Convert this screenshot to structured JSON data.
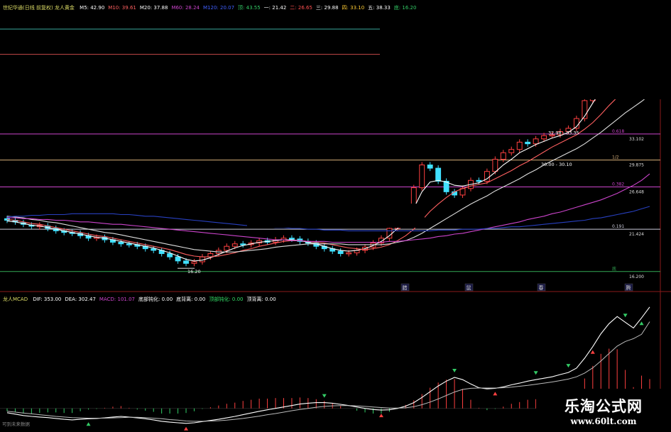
{
  "header1": {
    "title": "世纪华通(日线 前复权) 龙人黄金",
    "ma": [
      {
        "text": "M5: 42.90",
        "color": "#ffffff"
      },
      {
        "text": "M10: 39.61",
        "color": "#ff6060"
      },
      {
        "text": "M20: 37.88",
        "color": "#ffffff"
      },
      {
        "text": "M60: 28.24",
        "color": "#cc44cc"
      },
      {
        "text": "M120: 20.07",
        "color": "#4060ff"
      },
      {
        "text": "顶: 43.55",
        "color": "#33cc66"
      },
      {
        "text": "一: 21.42",
        "color": "#ffffff"
      },
      {
        "text": "二: 26.65",
        "color": "#ff5050"
      },
      {
        "text": "三: 29.88",
        "color": "#ffffff"
      },
      {
        "text": "四: 33.10",
        "color": "#ffcc33"
      },
      {
        "text": "五: 38.33",
        "color": "#ffffff"
      },
      {
        "text": "底: 16.20",
        "color": "#33cc66"
      }
    ]
  },
  "header2": {
    "title": "龙人MCAD",
    "items": [
      {
        "text": "DIF: 353.00",
        "color": "#ffffff"
      },
      {
        "text": "DEA: 302.47",
        "color": "#ffffff"
      },
      {
        "text": "MACD: 101.07",
        "color": "#cc44cc"
      },
      {
        "text": "底部钝化: 0.00",
        "color": "#ffffff"
      },
      {
        "text": "底背离: 0.00",
        "color": "#ffffff"
      },
      {
        "text": "顶部钝化: 0.00",
        "color": "#33dd66"
      },
      {
        "text": "顶背离: 0.00",
        "color": "#ffffff"
      }
    ]
  },
  "overlay_labels": {
    "zone_a": "32.98 - 33.35",
    "zone_b": "30.00 - 30.10",
    "low_price": "16.20",
    "bottom_left": "可到未来数据"
  },
  "logo": {
    "name": "乐淘公式网",
    "url": "www.60lt.com"
  },
  "chart_data": [
    {
      "type": "line",
      "name": "price",
      "ylim": [
        14,
        48
      ],
      "levels": [
        {
          "value": 46.0,
          "color": "#3aa89c",
          "label": ""
        },
        {
          "value": 42.9,
          "color": "#bb4444",
          "label": ""
        },
        {
          "value": 33.1,
          "color": "#cc44cc",
          "label": "0.618",
          "value_label": "33.102"
        },
        {
          "value": 29.9,
          "color": "#d8b07a",
          "label": "1/2",
          "value_label": "29.875"
        },
        {
          "value": 26.6,
          "color": "#cc44cc",
          "label": "0.382",
          "value_label": "26.648"
        },
        {
          "value": 21.4,
          "color": "#ccccdd",
          "label": "0.191",
          "value_label": "21.424"
        },
        {
          "value": 16.2,
          "color": "#33aa55",
          "label": "底",
          "value_label": "16.200"
        }
      ],
      "date_markers": [
        "腊",
        "鼠",
        "春",
        "腾"
      ],
      "close": [
        22.5,
        22.3,
        22.0,
        21.8,
        21.9,
        21.5,
        21.2,
        21.0,
        20.9,
        20.6,
        20.3,
        20.4,
        20.1,
        19.8,
        19.6,
        19.5,
        19.3,
        19.0,
        18.8,
        18.4,
        18.0,
        17.5,
        17.2,
        17.4,
        18.0,
        18.4,
        18.8,
        19.3,
        19.6,
        19.5,
        19.7,
        20.0,
        19.8,
        20.1,
        20.3,
        20.2,
        19.9,
        19.7,
        19.3,
        19.0,
        18.7,
        18.4,
        18.5,
        18.8,
        19.2,
        19.7,
        20.3,
        21.5,
        22.7,
        24.0,
        26.5,
        29.3,
        28.9,
        27.3,
        26.0,
        25.6,
        26.4,
        27.4,
        27.3,
        28.5,
        30.0,
        30.8,
        31.2,
        32.1,
        31.9,
        32.5,
        32.9,
        33.0,
        33.4,
        33.8,
        35.0,
        37.2,
        39.2,
        40.5,
        41.3,
        41.7,
        41.1,
        41.9,
        42.3,
        42.9
      ],
      "open": [
        22.7,
        22.5,
        22.2,
        21.9,
        21.7,
        21.8,
        21.5,
        21.2,
        21.0,
        20.9,
        20.6,
        20.3,
        20.4,
        20.1,
        19.8,
        19.6,
        19.5,
        19.3,
        19.0,
        18.8,
        18.4,
        18.0,
        17.5,
        17.2,
        17.4,
        18.0,
        18.4,
        18.8,
        19.3,
        19.6,
        19.5,
        19.7,
        20.0,
        19.8,
        20.1,
        20.3,
        20.2,
        19.9,
        19.7,
        19.3,
        19.0,
        18.7,
        18.4,
        18.5,
        18.8,
        19.2,
        19.7,
        20.3,
        21.5,
        22.7,
        24.0,
        26.5,
        29.3,
        28.9,
        27.3,
        26.0,
        25.6,
        26.4,
        27.4,
        27.3,
        28.5,
        30.0,
        30.8,
        31.2,
        32.1,
        31.9,
        32.5,
        32.9,
        33.0,
        33.4,
        33.8,
        35.0,
        37.2,
        39.2,
        40.5,
        41.3,
        41.7,
        41.1,
        41.9,
        42.3
      ],
      "series": [
        {
          "name": "M5",
          "color": "#ffffff",
          "values": [
            22.4,
            22.3,
            22.1,
            21.9,
            21.8,
            21.6,
            21.4,
            21.2,
            21.0,
            20.8,
            20.6,
            20.4,
            20.3,
            20.1,
            19.9,
            19.7,
            19.5,
            19.3,
            19.1,
            18.8,
            18.5,
            18.1,
            17.7,
            17.5,
            17.6,
            17.9,
            18.3,
            18.7,
            19.1,
            19.4,
            19.6,
            19.8,
            19.9,
            20.0,
            20.1,
            20.1,
            20.0,
            19.8,
            19.6,
            19.3,
            19.0,
            18.8,
            18.7,
            18.8,
            19.0,
            19.4,
            19.9,
            20.6,
            21.5,
            22.6,
            24.0,
            26.0,
            27.2,
            27.4,
            27.2,
            26.8,
            26.7,
            26.9,
            27.1,
            27.6,
            28.4,
            29.3,
            30.0,
            30.8,
            31.3,
            31.8,
            32.2,
            32.6,
            32.9,
            33.3,
            34.0,
            35.3,
            36.9,
            38.5,
            39.8,
            40.8,
            41.3,
            41.7,
            42.2,
            42.9
          ]
        },
        {
          "name": "M10",
          "color": "#ff6060",
          "values": [
            22.6,
            22.5,
            22.3,
            22.1,
            22.0,
            21.8,
            21.6,
            21.4,
            21.2,
            21.0,
            20.8,
            20.6,
            20.5,
            20.3,
            20.1,
            19.9,
            19.7,
            19.5,
            19.3,
            19.1,
            18.9,
            18.6,
            18.3,
            18.1,
            18.0,
            18.0,
            18.1,
            18.3,
            18.5,
            18.8,
            19.0,
            19.3,
            19.5,
            19.7,
            19.9,
            20.0,
            20.0,
            19.9,
            19.8,
            19.7,
            19.5,
            19.3,
            19.1,
            19.0,
            18.9,
            19.0,
            19.2,
            19.5,
            20.0,
            20.6,
            21.4,
            22.5,
            23.6,
            24.5,
            25.3,
            26.0,
            26.4,
            26.7,
            26.9,
            27.1,
            27.6,
            28.1,
            28.6,
            29.2,
            29.7,
            30.3,
            30.9,
            31.5,
            32.0,
            32.5,
            33.0,
            33.7,
            34.5,
            35.5,
            36.6,
            37.6,
            38.4,
            39.0,
            39.4,
            39.6
          ]
        },
        {
          "name": "M20",
          "color": "#dddddd",
          "values": [
            23.0,
            22.9,
            22.8,
            22.6,
            22.5,
            22.3,
            22.2,
            22.0,
            21.8,
            21.6,
            21.4,
            21.2,
            21.0,
            20.9,
            20.7,
            20.5,
            20.3,
            20.1,
            19.9,
            19.7,
            19.5,
            19.3,
            19.1,
            18.9,
            18.8,
            18.7,
            18.6,
            18.6,
            18.6,
            18.7,
            18.8,
            18.9,
            19.0,
            19.2,
            19.3,
            19.4,
            19.5,
            19.6,
            19.6,
            19.6,
            19.6,
            19.6,
            19.5,
            19.5,
            19.5,
            19.5,
            19.5,
            19.6,
            19.8,
            20.0,
            20.4,
            20.9,
            21.5,
            22.1,
            22.7,
            23.3,
            23.9,
            24.5,
            25.0,
            25.5,
            26.1,
            26.6,
            27.1,
            27.6,
            28.2,
            28.7,
            29.3,
            29.8,
            30.3,
            30.8,
            31.3,
            31.9,
            32.6,
            33.3,
            34.1,
            34.9,
            35.7,
            36.4,
            37.1,
            37.9
          ]
        },
        {
          "name": "M60",
          "color": "#cc44cc",
          "values": [
            22.8,
            22.8,
            22.7,
            22.7,
            22.6,
            22.6,
            22.5,
            22.5,
            22.4,
            22.3,
            22.3,
            22.2,
            22.1,
            22.0,
            22.0,
            21.9,
            21.8,
            21.7,
            21.6,
            21.5,
            21.4,
            21.3,
            21.2,
            21.1,
            21.0,
            20.9,
            20.8,
            20.7,
            20.6,
            20.5,
            20.4,
            20.3,
            20.2,
            20.1,
            20.1,
            20.0,
            20.0,
            19.9,
            19.9,
            19.9,
            19.8,
            19.8,
            19.8,
            19.8,
            19.8,
            19.8,
            19.8,
            19.9,
            19.9,
            20.0,
            20.1,
            20.2,
            20.3,
            20.5,
            20.6,
            20.8,
            20.9,
            21.1,
            21.3,
            21.5,
            21.7,
            21.9,
            22.1,
            22.3,
            22.6,
            22.8,
            23.0,
            23.3,
            23.5,
            23.8,
            24.1,
            24.4,
            24.7,
            25.0,
            25.4,
            25.8,
            26.3,
            26.8,
            27.4,
            28.2
          ]
        },
        {
          "name": "M120",
          "color": "#2840c0",
          "values": [
            22.9,
            23.0,
            23.0,
            23.1,
            23.1,
            23.2,
            23.2,
            23.2,
            23.3,
            23.3,
            23.3,
            23.3,
            23.3,
            23.3,
            23.2,
            23.2,
            23.1,
            23.0,
            23.0,
            22.9,
            22.8,
            22.7,
            22.6,
            22.5,
            22.4,
            22.3,
            22.2,
            22.1,
            22.0,
            21.9,
            21.8,
            21.8,
            21.7,
            21.6,
            21.6,
            21.5,
            21.5,
            21.4,
            21.4,
            21.3,
            21.3,
            21.3,
            21.2,
            21.2,
            21.2,
            21.2,
            21.2,
            21.2,
            21.2,
            21.2,
            21.2,
            21.2,
            21.2,
            21.3,
            21.3,
            21.3,
            21.4,
            21.4,
            21.4,
            21.5,
            21.5,
            21.6,
            21.7,
            21.7,
            21.8,
            21.9,
            22.0,
            22.1,
            22.2,
            22.3,
            22.4,
            22.5,
            22.7,
            22.8,
            23.0,
            23.2,
            23.4,
            23.6,
            23.9,
            24.2
          ]
        }
      ]
    },
    {
      "type": "bar",
      "name": "龙人MCAD",
      "ylim": [
        -60,
        360
      ],
      "dif": [
        -15,
        -20,
        -25,
        -28,
        -30,
        -32,
        -35,
        -38,
        -40,
        -38,
        -36,
        -35,
        -33,
        -30,
        -28,
        -30,
        -33,
        -36,
        -40,
        -45,
        -48,
        -50,
        -52,
        -50,
        -46,
        -42,
        -38,
        -33,
        -28,
        -22,
        -16,
        -10,
        -5,
        0,
        5,
        10,
        15,
        18,
        20,
        20,
        18,
        14,
        10,
        5,
        0,
        -4,
        -6,
        -5,
        0,
        8,
        20,
        38,
        58,
        78,
        95,
        108,
        100,
        85,
        72,
        68,
        70,
        75,
        82,
        88,
        95,
        100,
        105,
        110,
        118,
        125,
        140,
        175,
        215,
        260,
        295,
        320,
        300,
        280,
        315,
        353
      ],
      "dea": [
        -10,
        -13,
        -16,
        -19,
        -22,
        -25,
        -28,
        -30,
        -32,
        -33,
        -34,
        -34,
        -34,
        -33,
        -32,
        -31,
        -31,
        -32,
        -34,
        -36,
        -39,
        -41,
        -44,
        -45,
        -45,
        -44,
        -43,
        -41,
        -38,
        -35,
        -31,
        -27,
        -22,
        -18,
        -13,
        -8,
        -4,
        0,
        4,
        7,
        9,
        10,
        10,
        9,
        7,
        5,
        3,
        1,
        1,
        2,
        6,
        13,
        22,
        33,
        45,
        57,
        66,
        70,
        71,
        71,
        71,
        72,
        74,
        77,
        80,
        84,
        88,
        92,
        97,
        102,
        110,
        123,
        141,
        165,
        191,
        217,
        233,
        243,
        258,
        302
      ],
      "markers": [
        {
          "index": 10,
          "type": "up",
          "color": "#33cc66"
        },
        {
          "index": 22,
          "type": "up",
          "color": "#ff4040"
        },
        {
          "index": 39,
          "type": "down",
          "color": "#33cc66"
        },
        {
          "index": 46,
          "type": "up",
          "color": "#ff4040"
        },
        {
          "index": 55,
          "type": "down",
          "color": "#33cc66"
        },
        {
          "index": 60,
          "type": "up",
          "color": "#ff4040"
        },
        {
          "index": 65,
          "type": "down",
          "color": "#33cc66"
        },
        {
          "index": 69,
          "type": "down",
          "color": "#33cc66"
        },
        {
          "index": 72,
          "type": "up",
          "color": "#ff4040"
        },
        {
          "index": 76,
          "type": "down",
          "color": "#33cc66"
        },
        {
          "index": 78,
          "type": "up",
          "color": "#33cc66"
        }
      ]
    }
  ]
}
